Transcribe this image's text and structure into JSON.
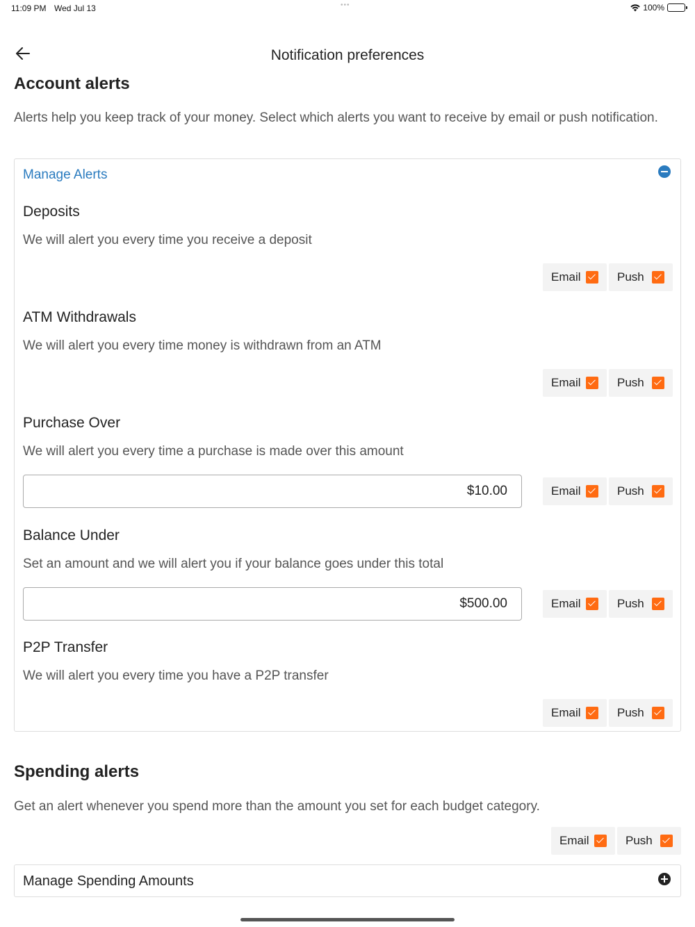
{
  "status_bar": {
    "time": "11:09 PM",
    "date": "Wed Jul 13",
    "battery": "100%"
  },
  "nav": {
    "title": "Notification preferences",
    "back_icon": "arrow-left-icon"
  },
  "account_alerts": {
    "title": "Account alerts",
    "description": "Alerts help you keep track of your money. Select which alerts you want to receive by email or push notification.",
    "manage_label": "Manage Alerts",
    "items": [
      {
        "title": "Deposits",
        "description": "We will alert you every time you receive a deposit",
        "email_label": "Email",
        "push_label": "Push",
        "email_checked": true,
        "push_checked": true
      },
      {
        "title": "ATM Withdrawals",
        "description": "We will alert you every time money is withdrawn from an ATM",
        "email_label": "Email",
        "push_label": "Push",
        "email_checked": true,
        "push_checked": true
      },
      {
        "title": "Purchase Over",
        "description": "We will alert you every time a purchase is made over this amount",
        "amount": "$10.00",
        "email_label": "Email",
        "push_label": "Push",
        "email_checked": true,
        "push_checked": true
      },
      {
        "title": "Balance Under",
        "description": "Set an amount and we will alert you if your balance goes under this total",
        "amount": "$500.00",
        "email_label": "Email",
        "push_label": "Push",
        "email_checked": true,
        "push_checked": true
      },
      {
        "title": "P2P Transfer",
        "description": "We will alert you every time you have a P2P transfer",
        "email_label": "Email",
        "push_label": "Push",
        "email_checked": true,
        "push_checked": true
      }
    ]
  },
  "spending_alerts": {
    "title": "Spending alerts",
    "description": "Get an alert whenever you spend more than the amount you set for each budget category.",
    "email_label": "Email",
    "push_label": "Push",
    "email_checked": true,
    "push_checked": true,
    "manage_label": "Manage Spending Amounts"
  },
  "colors": {
    "accent": "#2a7bbf",
    "checkbox": "#ff6b12"
  }
}
